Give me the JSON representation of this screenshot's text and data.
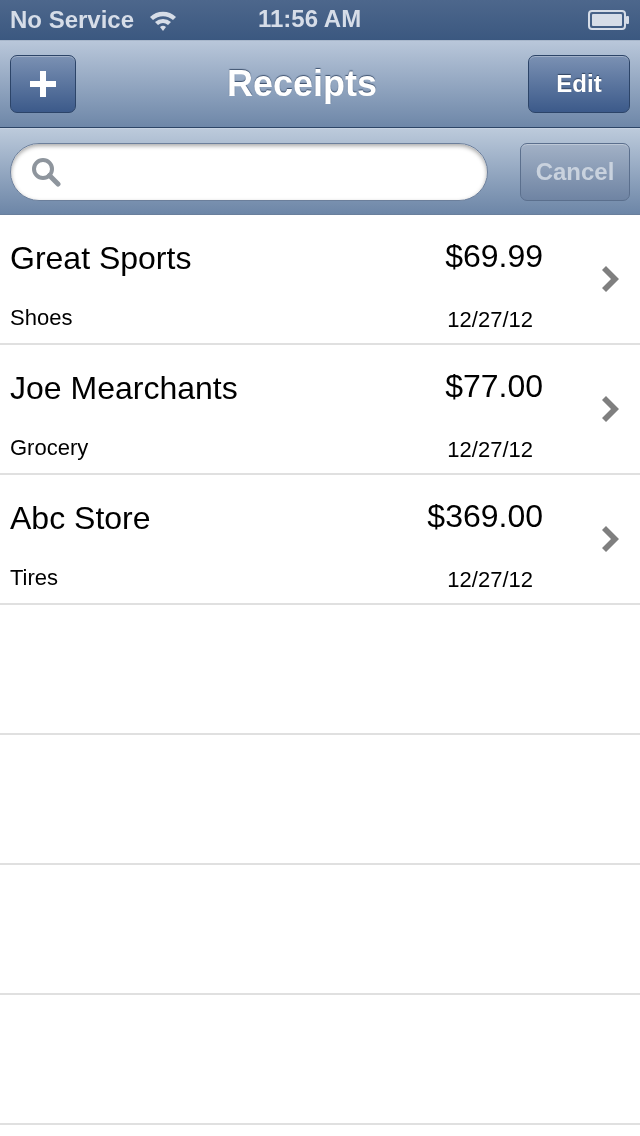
{
  "status_bar": {
    "carrier": "No Service",
    "time": "11:56 AM"
  },
  "nav_bar": {
    "title": "Receipts",
    "right_button": "Edit"
  },
  "search_bar": {
    "cancel": {
      "label": "Cancel",
      "disabled": true
    }
  },
  "receipts": [
    {
      "name": "Great Sports",
      "category": "Shoes",
      "amount": "$69.99",
      "date": "12/27/12"
    },
    {
      "name": "Joe Mearchants",
      "category": "Grocery",
      "amount": "$77.00",
      "date": "12/27/12"
    },
    {
      "name": "Abc Store",
      "category": "Tires",
      "amount": "$369.00",
      "date": "12/27/12"
    }
  ]
}
